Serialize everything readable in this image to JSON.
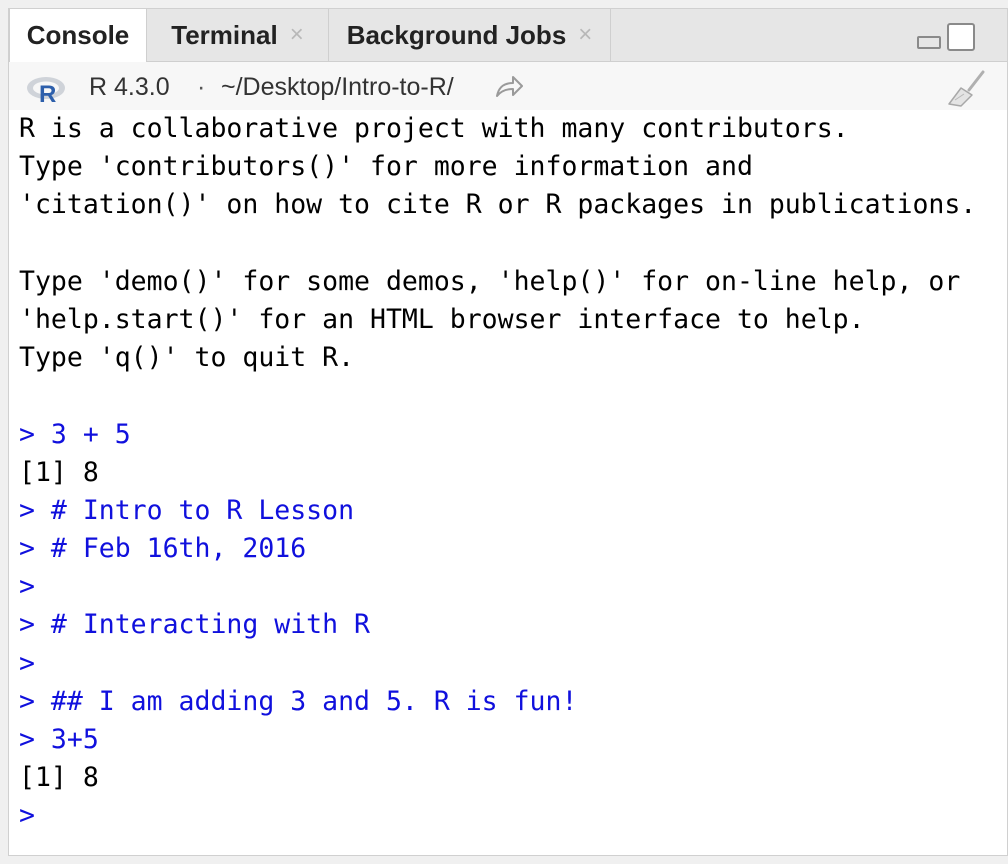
{
  "tabs": [
    {
      "label": "Console",
      "closable": false,
      "active": true
    },
    {
      "label": "Terminal",
      "closable": true,
      "active": false
    },
    {
      "label": "Background Jobs",
      "closable": true,
      "active": false
    }
  ],
  "close_glyph": "×",
  "toolbar": {
    "r_version": "R 4.3.0",
    "separator": "·",
    "path": "~/Desktop/Intro-to-R/"
  },
  "colors": {
    "input_text": "#1010dd",
    "output_text": "#000000",
    "r_logo_blue": "#2d5fab"
  },
  "icons": [
    "r-logo-icon",
    "go-to-directory-icon",
    "minimize-icon",
    "maximize-icon",
    "clear-console-broom-icon"
  ],
  "console": {
    "lines": [
      {
        "type": "out",
        "text": "R is a collaborative project with many contributors."
      },
      {
        "type": "out",
        "text": "Type 'contributors()' for more information and"
      },
      {
        "type": "out",
        "text": "'citation()' on how to cite R or R packages in publications."
      },
      {
        "type": "out",
        "text": ""
      },
      {
        "type": "out",
        "text": "Type 'demo()' for some demos, 'help()' for on-line help, or"
      },
      {
        "type": "out",
        "text": "'help.start()' for an HTML browser interface to help."
      },
      {
        "type": "out",
        "text": "Type 'q()' to quit R."
      },
      {
        "type": "out",
        "text": ""
      },
      {
        "type": "in",
        "text": "> 3 + 5"
      },
      {
        "type": "out",
        "text": "[1] 8"
      },
      {
        "type": "in",
        "text": "> # Intro to R Lesson"
      },
      {
        "type": "in",
        "text": "> # Feb 16th, 2016"
      },
      {
        "type": "in",
        "text": ">"
      },
      {
        "type": "in",
        "text": "> # Interacting with R"
      },
      {
        "type": "in",
        "text": ">"
      },
      {
        "type": "in",
        "text": "> ## I am adding 3 and 5. R is fun!"
      },
      {
        "type": "in",
        "text": "> 3+5"
      },
      {
        "type": "out",
        "text": "[1] 8"
      },
      {
        "type": "in",
        "text": ">"
      }
    ]
  }
}
